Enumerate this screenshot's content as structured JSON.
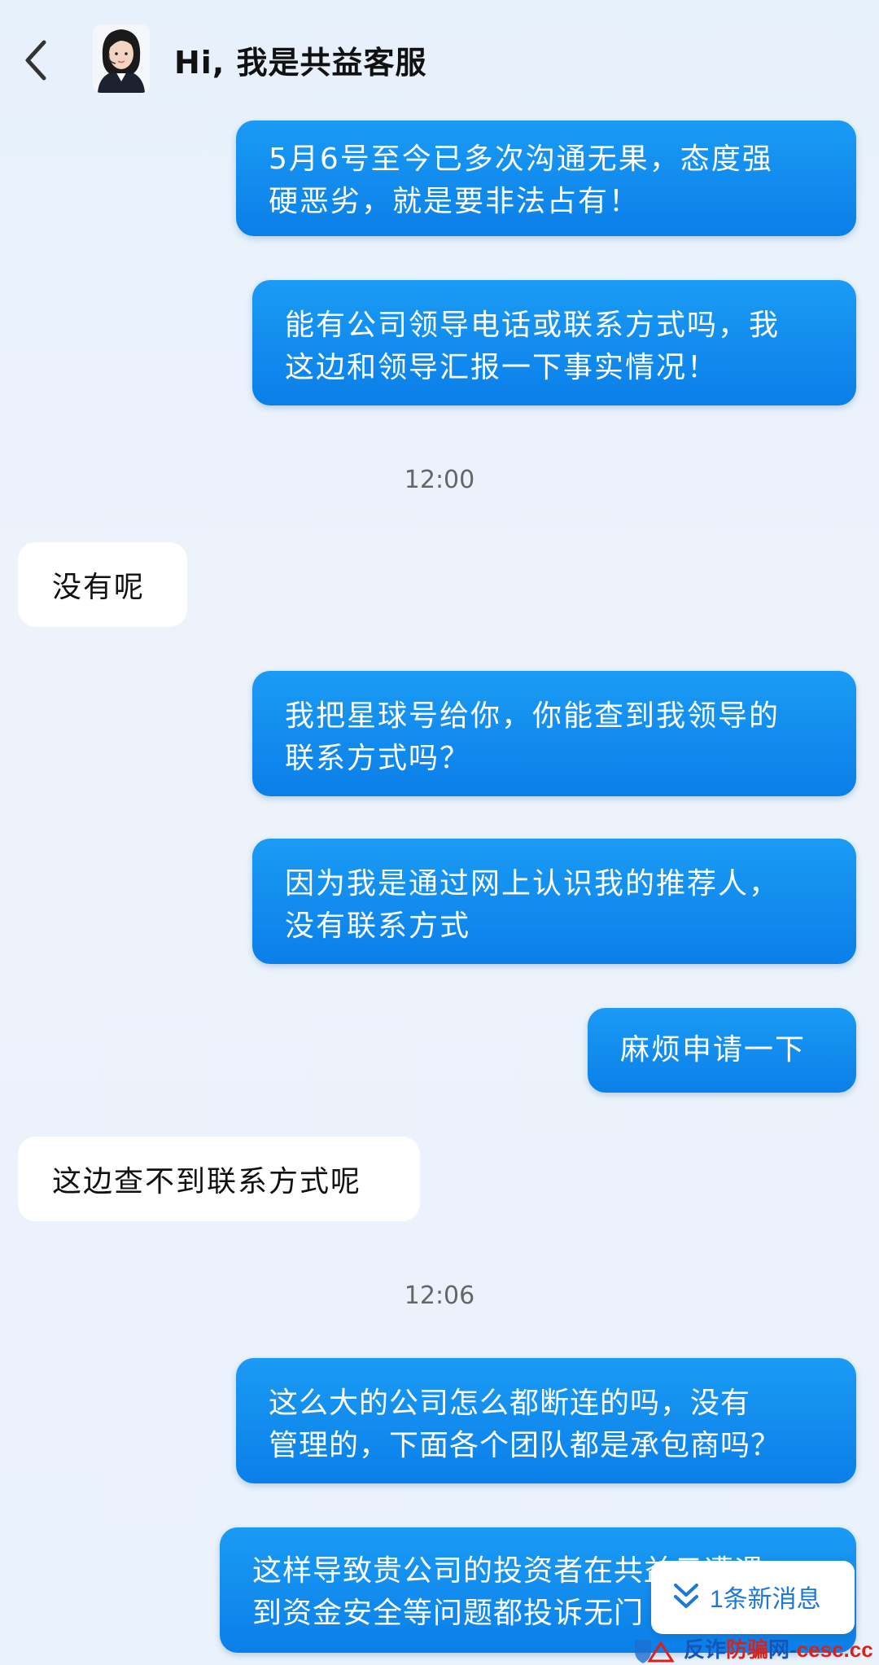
{
  "header": {
    "title": "Hi, 我是共益客服",
    "back_icon": "chevron-left-icon",
    "avatar_icon": "customer-service-avatar"
  },
  "messages": [
    {
      "side": "out",
      "text_lines": [
        "5月6号至今已多次沟通无果，态度强",
        "硬恶劣，就是要非法占有！"
      ]
    },
    {
      "side": "out",
      "text_lines": [
        "能有公司领导电话或联系方式吗，我",
        "这边和领导汇报一下事实情况！"
      ]
    },
    {
      "side": "time",
      "text": "12:00"
    },
    {
      "side": "in",
      "text": "没有呢"
    },
    {
      "side": "out",
      "text_lines": [
        "我把星球号给你，你能查到我领导的",
        "联系方式吗？"
      ]
    },
    {
      "side": "out",
      "text_lines": [
        "因为我是通过网上认识我的推荐人，",
        "没有联系方式"
      ]
    },
    {
      "side": "out",
      "text": "麻烦申请一下"
    },
    {
      "side": "in",
      "text": "这边查不到联系方式呢"
    },
    {
      "side": "time",
      "text": "12:06"
    },
    {
      "side": "out",
      "text_lines": [
        "这么大的公司怎么都断连的吗，没有",
        "管理的，下面各个团队都是承包商吗？"
      ]
    },
    {
      "side": "out",
      "text_lines": [
        "这样导致贵公司的投资者在共益云遭遇",
        "到资金安全等问题都投诉无门"
      ]
    }
  ],
  "new_message_button": {
    "label": "1条新消息",
    "icon": "double-chevron-down-icon"
  },
  "watermark": {
    "part1": "反诈",
    "part2": "防骗",
    "part3": "网-",
    "part4": "cesc.cc"
  },
  "colors": {
    "outgoing_bubble": "#0b7fe8",
    "incoming_bubble": "#ffffff",
    "timestamp": "#666666",
    "accent": "#1d77d6"
  }
}
